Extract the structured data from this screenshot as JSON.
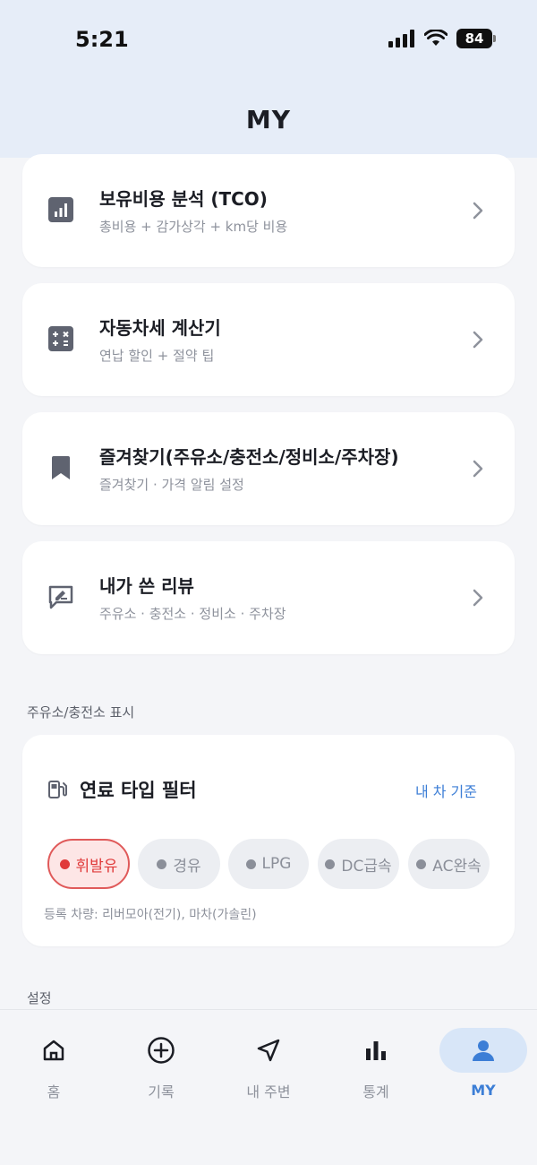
{
  "status_bar": {
    "time": "5:21",
    "battery": "84"
  },
  "header": {
    "title": "MY"
  },
  "menu": [
    {
      "title": "보유비용 분석 (TCO)",
      "subtitle": "총비용 + 감가상각 + km당 비용",
      "icon": "chart-icon"
    },
    {
      "title": "자동차세 계산기",
      "subtitle": "연납 할인 + 절약 팁",
      "icon": "calculator-icon"
    },
    {
      "title": "즐겨찾기(주유소/충전소/정비소/주차장)",
      "subtitle": "즐겨찾기 · 가격 알림 설정",
      "icon": "bookmark-icon"
    },
    {
      "title": "내가 쓴 리뷰",
      "subtitle": "주유소 · 충전소 · 정비소 · 주차장",
      "icon": "review-icon"
    }
  ],
  "station_section": {
    "label": "주유소/충전소 표시"
  },
  "fuel_filter": {
    "title": "연료 타입 필터",
    "link": "내 차 기준",
    "chips": [
      {
        "label": "휘발유",
        "active": true
      },
      {
        "label": "경유",
        "active": false
      },
      {
        "label": "LPG",
        "active": false
      },
      {
        "label": "DC급속",
        "active": false
      },
      {
        "label": "AC완속",
        "active": false
      }
    ],
    "note": "등록 차량: 리버모아(전기), 마차(가솔린)"
  },
  "settings_section": {
    "label": "설정"
  },
  "tabs": [
    {
      "label": "홈",
      "icon": "home-icon"
    },
    {
      "label": "기록",
      "icon": "plus-circle-icon"
    },
    {
      "label": "내 주변",
      "icon": "navigation-icon"
    },
    {
      "label": "통계",
      "icon": "bar-chart-icon"
    },
    {
      "label": "MY",
      "icon": "user-icon",
      "active": true
    }
  ],
  "colors": {
    "accent": "#3c7ed6",
    "active_chip": "#e03a3a",
    "header_bg": "#e6edf8"
  }
}
